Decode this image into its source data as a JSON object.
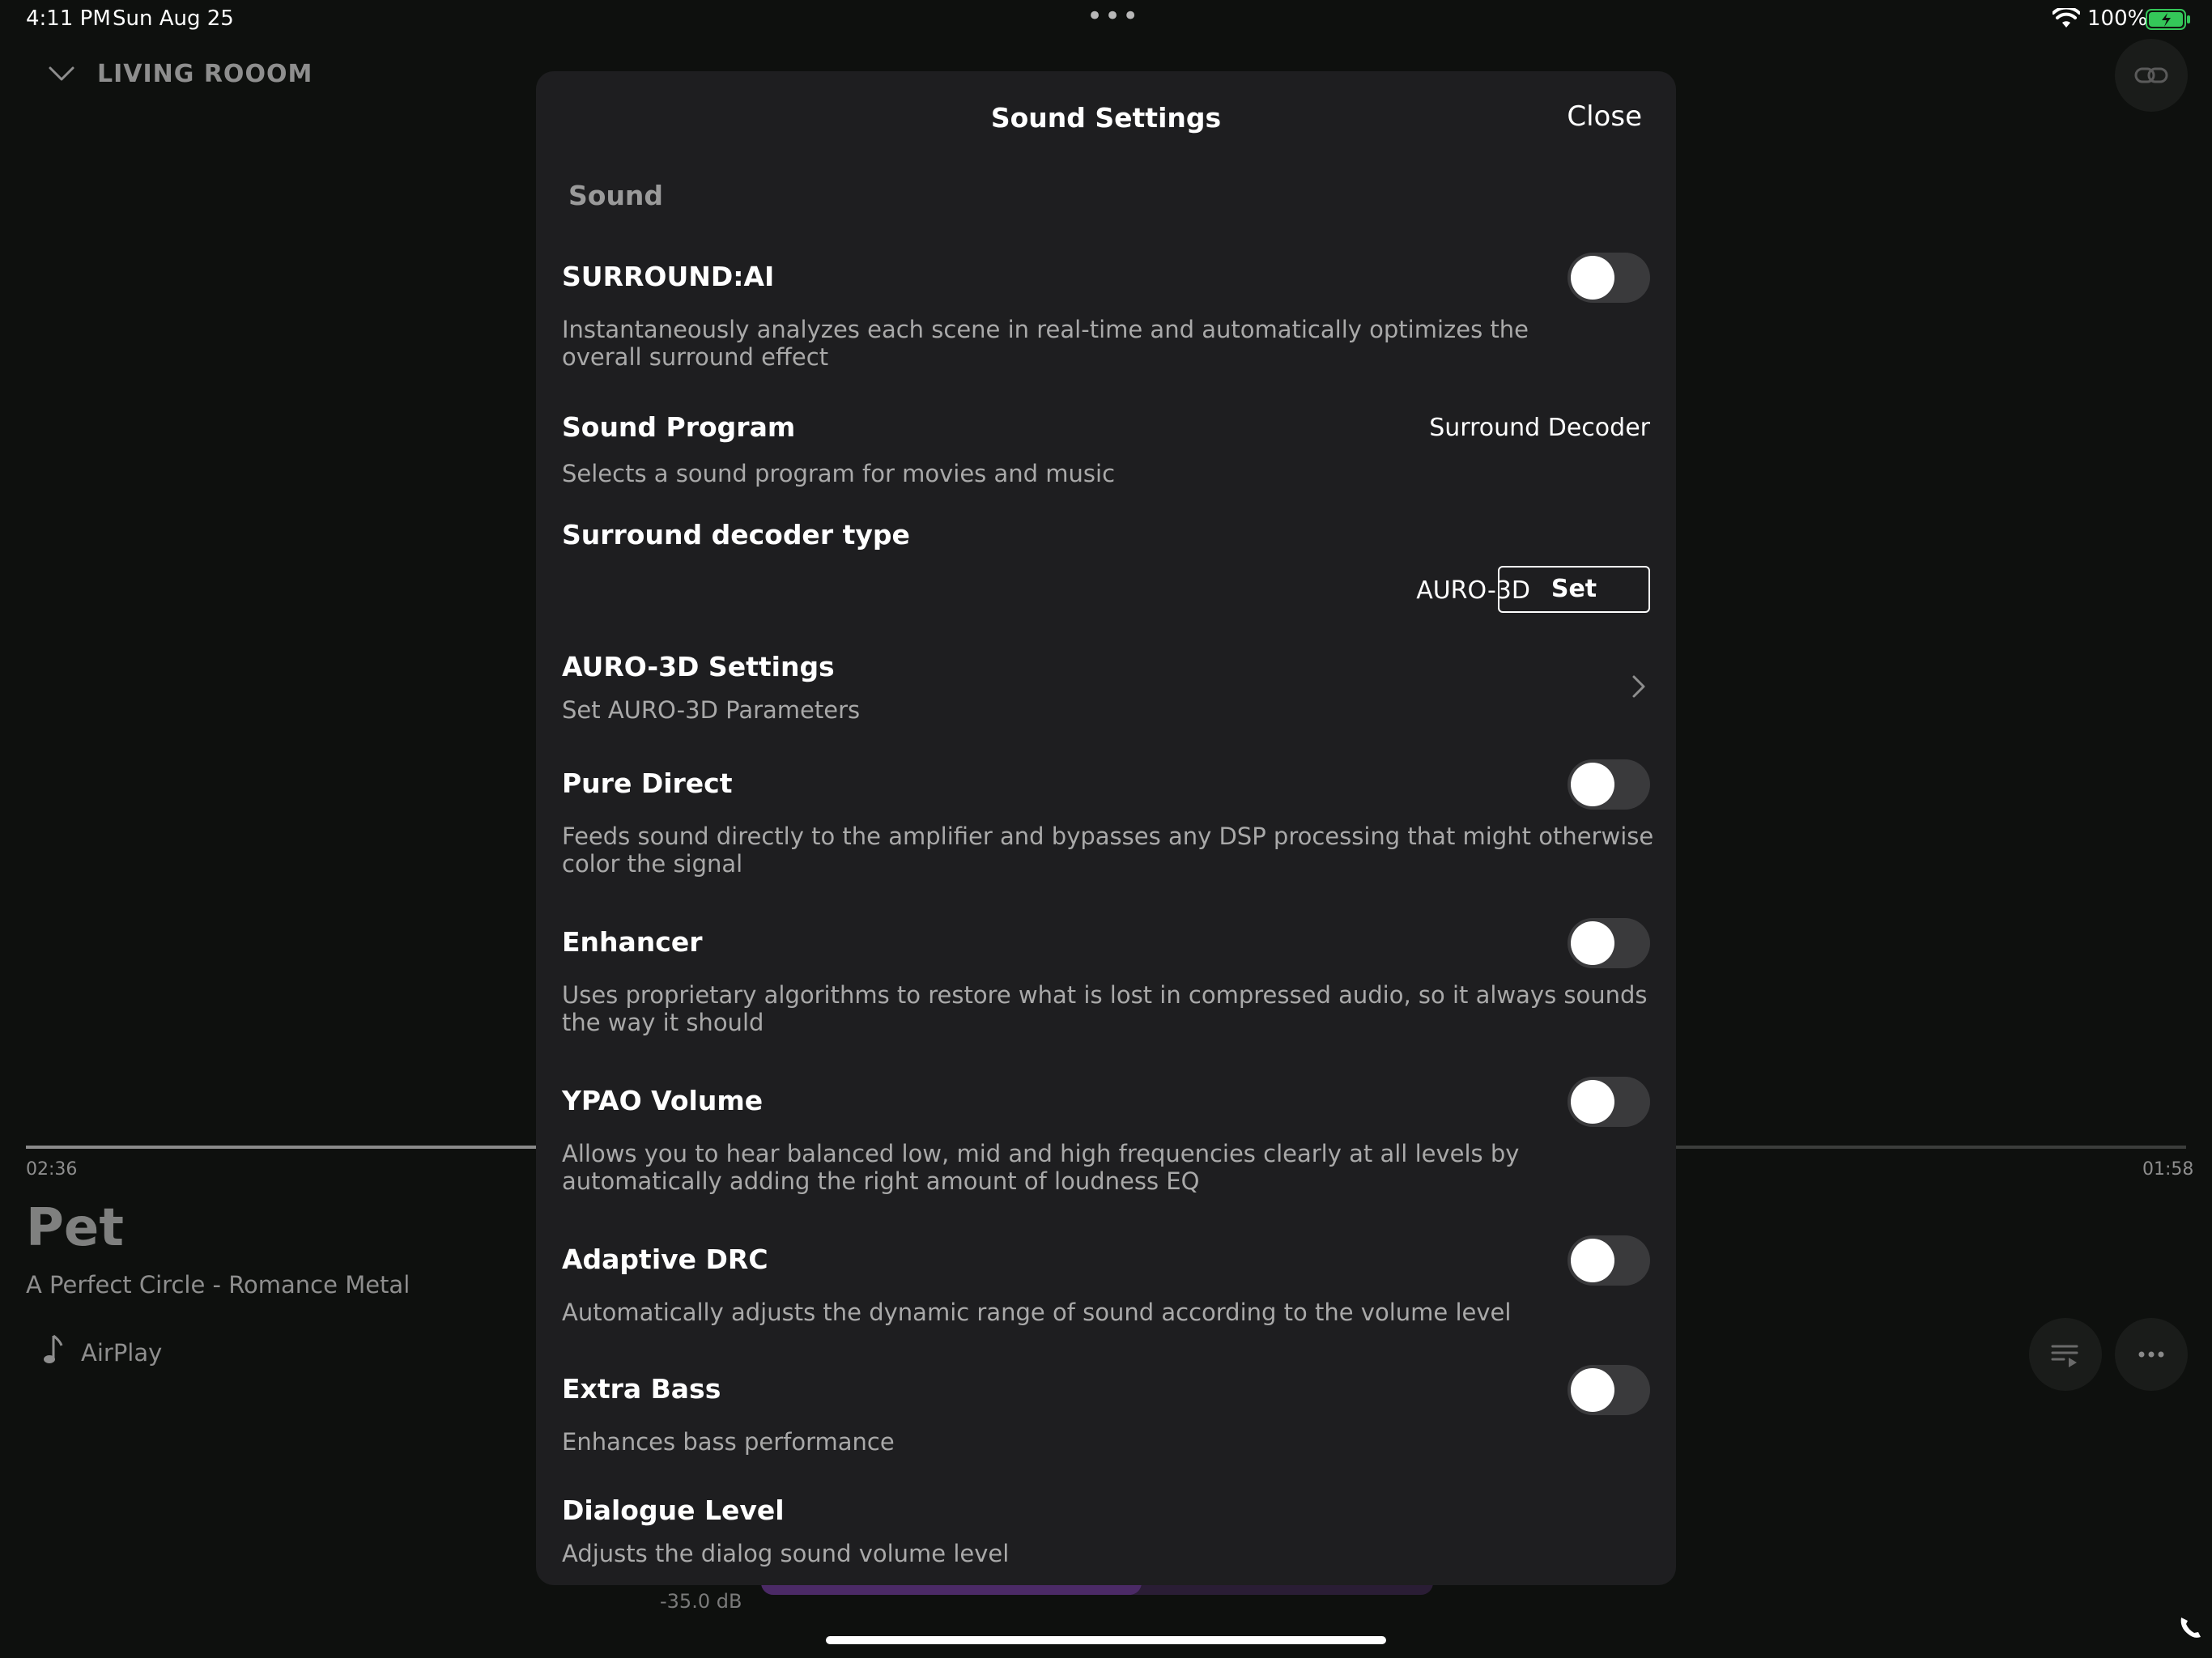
{
  "status_bar": {
    "time": "4:11 PM",
    "date": "Sun Aug 25",
    "battery_percent": "100%",
    "battery_color": "#34c759"
  },
  "player": {
    "room_name": "LIVING ROOOM",
    "time_elapsed": "02:36",
    "time_remaining": "01:58",
    "progress_fraction": 0.57,
    "track_title": "Pet",
    "track_subtitle": "A Perfect Circle - Romance Metal",
    "source_label": "AirPlay",
    "volume_label": "-35.0 dB",
    "volume_accent": "#4b2a66",
    "icons": [
      "chevron-down-icon",
      "link-icon",
      "music-note-icon",
      "queue-icon",
      "more-icon",
      "phone-icon"
    ]
  },
  "modal": {
    "title": "Sound Settings",
    "close_label": "Close",
    "section_header": "Sound",
    "surround_ai": {
      "title": "SURROUND:AI",
      "description": "Instantaneously analyzes each scene in real-time and automatically optimizes the overall surround effect",
      "enabled": false
    },
    "sound_program": {
      "title": "Sound Program",
      "value": "Surround Decoder",
      "description": "Selects a sound program for movies and music"
    },
    "decoder_type": {
      "title": "Surround decoder type",
      "value": "AURO-3D",
      "button_label": "Set"
    },
    "auro_settings": {
      "title": "AURO-3D Settings",
      "description": "Set AURO-3D Parameters"
    },
    "pure_direct": {
      "title": "Pure Direct",
      "description": "Feeds sound directly to the amplifier and bypasses any DSP processing that might otherwise color the signal",
      "enabled": false
    },
    "enhancer": {
      "title": "Enhancer",
      "description": "Uses proprietary algorithms to restore what is lost in compressed audio, so it always sounds the way it should",
      "enabled": false
    },
    "ypao_volume": {
      "title": "YPAO Volume",
      "description": "Allows you to hear balanced low, mid and high frequencies clearly at all levels by automatically adding the right amount of loudness EQ",
      "enabled": false
    },
    "adaptive_drc": {
      "title": "Adaptive DRC",
      "description": "Automatically adjusts the dynamic range of sound according to the volume level",
      "enabled": false
    },
    "extra_bass": {
      "title": "Extra Bass",
      "description": "Enhances bass performance",
      "enabled": false
    },
    "dialogue_level": {
      "title": "Dialogue Level",
      "description": "Adjusts the dialog sound volume level"
    }
  }
}
